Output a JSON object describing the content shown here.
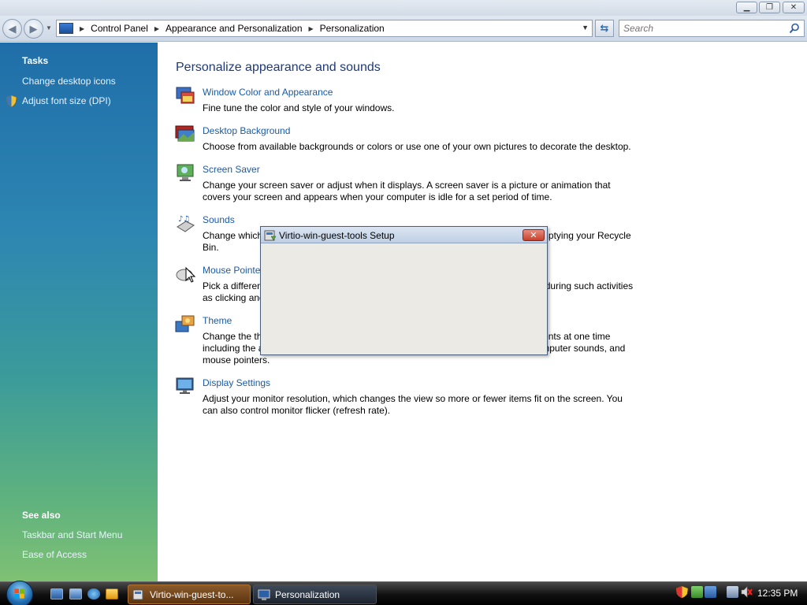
{
  "window": {
    "min_label": "▁",
    "max_label": "❐",
    "close_label": "✕"
  },
  "address": {
    "crumbs": [
      "Control Panel",
      "Appearance and Personalization",
      "Personalization"
    ],
    "search_placeholder": "Search"
  },
  "sidebar": {
    "tasks_heading": "Tasks",
    "tasks": [
      "Change desktop icons",
      "Adjust font size (DPI)"
    ],
    "see_also_heading": "See also",
    "see_also": [
      "Taskbar and Start Menu",
      "Ease of Access"
    ]
  },
  "main": {
    "title": "Personalize appearance and sounds",
    "items": [
      {
        "icon": "window-color-icon",
        "link": "Window Color and Appearance",
        "desc": "Fine tune the color and style of your windows."
      },
      {
        "icon": "desktop-background-icon",
        "link": "Desktop Background",
        "desc": "Choose from available backgrounds or colors or use one of your own pictures to decorate the desktop."
      },
      {
        "icon": "screen-saver-icon",
        "link": "Screen Saver",
        "desc": "Change your screen saver or adjust when it displays. A screen saver is a picture or animation that covers your screen and appears when your computer is idle for a set period of time."
      },
      {
        "icon": "sounds-icon",
        "link": "Sounds",
        "desc": "Change which sounds are heard when you do everything from getting e-mail to emptying your Recycle Bin."
      },
      {
        "icon": "mouse-pointer-icon",
        "link": "Mouse Pointers",
        "desc": "Pick a different mouse pointer. You can also change how the mouse pointer looks during such activities as clicking and selecting."
      },
      {
        "icon": "theme-icon",
        "link": "Theme",
        "desc": "Change the theme. Themes can change a wide range of visual and auditory elements at one time including the appearance of menus, icons, backgrounds, screen savers, some computer sounds, and mouse pointers."
      },
      {
        "icon": "display-settings-icon",
        "link": "Display Settings",
        "desc": "Adjust your monitor resolution, which changes the view so more or fewer items fit on the screen. You can also control monitor flicker (refresh rate)."
      }
    ]
  },
  "dialog": {
    "title": "Virtio-win-guest-tools Setup",
    "close_label": "✕"
  },
  "taskbar": {
    "tasks": [
      "Virtio-win-guest-to...",
      "Personalization"
    ],
    "clock": "12:35 PM"
  }
}
